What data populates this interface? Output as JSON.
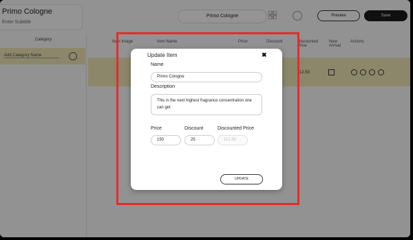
{
  "app": {
    "store_title": "Primo Cologne",
    "store_subtitle": "Enter Subtitle",
    "top_name": "Primo Cologne",
    "preview_label": "Preview",
    "save_label": "Save"
  },
  "sidebar": {
    "heading": "Category",
    "add_placeholder": "Add Category Name"
  },
  "table": {
    "columns": [
      "Item Image",
      "Item Name",
      "Price",
      "Discount",
      "Discounted Price",
      "New Arrival",
      "Actions"
    ],
    "row": {
      "discounted": "112.50"
    }
  },
  "modal": {
    "title": "Update Item",
    "close": "✖",
    "name_label": "Name",
    "name_value": "Primo Cologne",
    "description_label": "Description",
    "description_value": "This is the next highest fragrance concentration one can get",
    "price_label": "Price",
    "price_value": "150",
    "discount_label": "Discount",
    "discount_value": "25",
    "discounted_label": "Discounted Price",
    "discounted_value": "112.50",
    "update_label": "UPDATE"
  },
  "colors": {
    "highlight": "#e52b2b",
    "row_band": "#f1e9b7"
  }
}
